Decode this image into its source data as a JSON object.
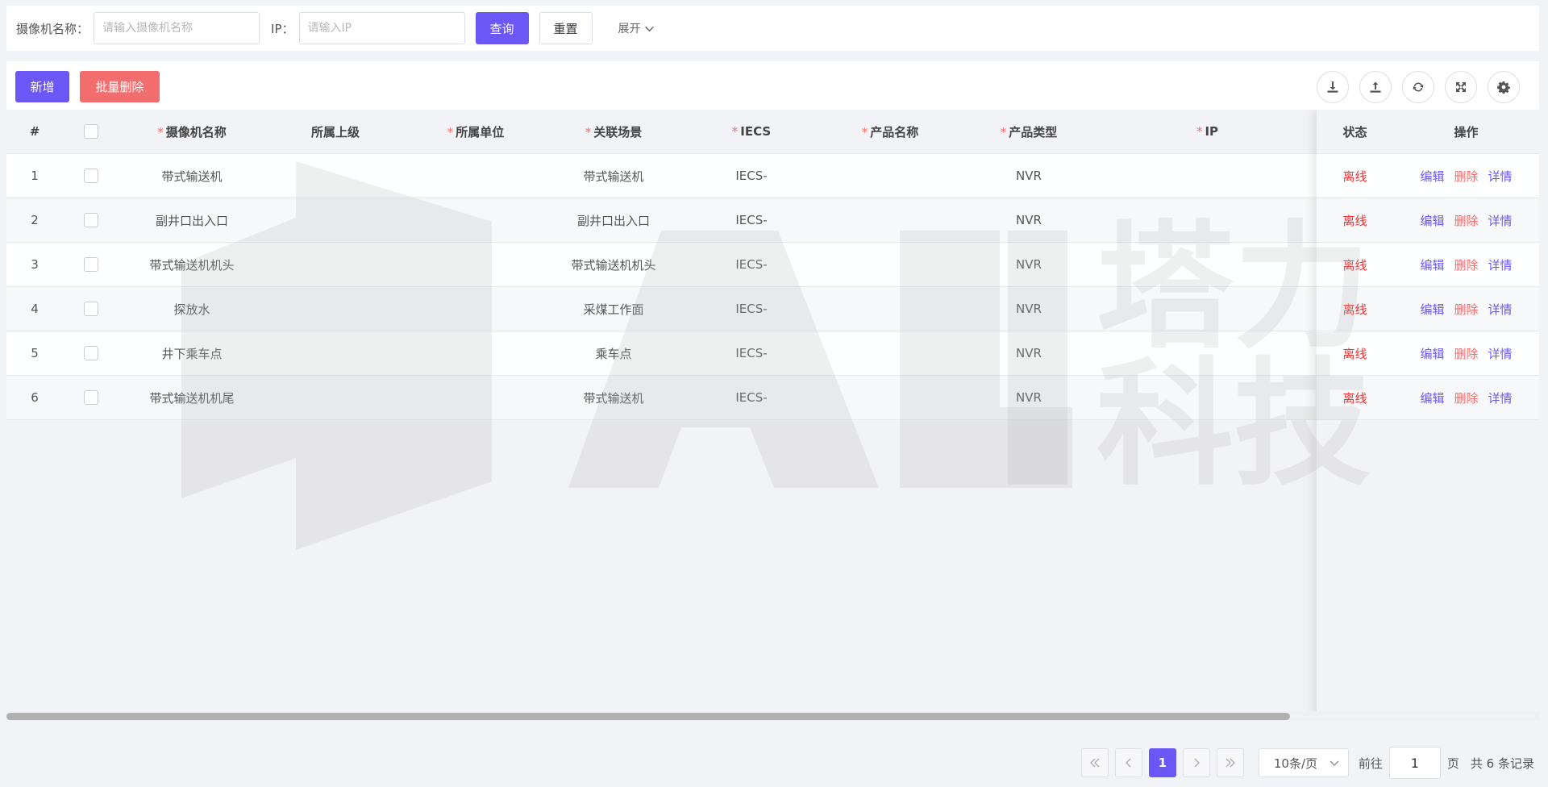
{
  "search": {
    "camera_name_label": "摄像机名称：",
    "camera_name_placeholder": "请输入摄像机名称",
    "ip_label": "IP：",
    "ip_placeholder": "请输入IP",
    "query_label": "查询",
    "reset_label": "重置",
    "expand_label": "展开"
  },
  "toolbar": {
    "add_label": "新增",
    "batch_delete_label": "批量删除",
    "icons": [
      "download-icon",
      "upload-icon",
      "refresh-icon",
      "fullscreen-icon",
      "settings-icon"
    ]
  },
  "table": {
    "headers": {
      "index": "#",
      "camera_name": "摄像机名称",
      "parent": "所属上级",
      "unit": "所属单位",
      "scene": "关联场景",
      "iecs": "IECS",
      "product_name": "产品名称",
      "product_type": "产品类型",
      "ip": "IP",
      "status": "状态",
      "actions": "操作"
    },
    "required_mark": "*",
    "rows": [
      {
        "index": "1",
        "camera_name": "带式输送机",
        "parent": "",
        "unit": "",
        "scene": "带式输送机",
        "iecs": "IECS-",
        "product_name": "",
        "product_type": "NVR",
        "ip": "",
        "status": "离线"
      },
      {
        "index": "2",
        "camera_name": "副井口出入口",
        "parent": "",
        "unit": "",
        "scene": "副井口出入口",
        "iecs": "IECS-",
        "product_name": "",
        "product_type": "NVR",
        "ip": "",
        "status": "离线"
      },
      {
        "index": "3",
        "camera_name": "带式输送机机头",
        "parent": "",
        "unit": "",
        "scene": "带式输送机机头",
        "iecs": "IECS-",
        "product_name": "",
        "product_type": "NVR",
        "ip": "",
        "status": "离线"
      },
      {
        "index": "4",
        "camera_name": "探放水",
        "parent": "",
        "unit": "",
        "scene": "采煤工作面",
        "iecs": "IECS-",
        "product_name": "",
        "product_type": "NVR",
        "ip": "",
        "status": "离线"
      },
      {
        "index": "5",
        "camera_name": "井下乘车点",
        "parent": "",
        "unit": "",
        "scene": "乘车点",
        "iecs": "IECS-",
        "product_name": "",
        "product_type": "NVR",
        "ip": "",
        "status": "离线"
      },
      {
        "index": "6",
        "camera_name": "带式输送机机尾",
        "parent": "",
        "unit": "",
        "scene": "带式输送机",
        "iecs": "IECS-",
        "product_name": "",
        "product_type": "NVR",
        "ip": "",
        "status": "离线"
      }
    ],
    "actions": {
      "edit": "编辑",
      "delete": "删除",
      "detail": "详情"
    }
  },
  "watermark": {
    "text_en": "TALI",
    "text_cn_1": "塔力",
    "text_cn_2": "科技"
  },
  "pagination": {
    "current_page": "1",
    "page_size": "10条/页",
    "goto_prefix": "前往",
    "goto_value": "1",
    "goto_suffix": "页",
    "total_text": "共 6 条记录"
  },
  "colors": {
    "primary": "#6b57f5",
    "danger": "#f26d6d",
    "offline": "#f23030",
    "background": "#f2f3f7"
  }
}
